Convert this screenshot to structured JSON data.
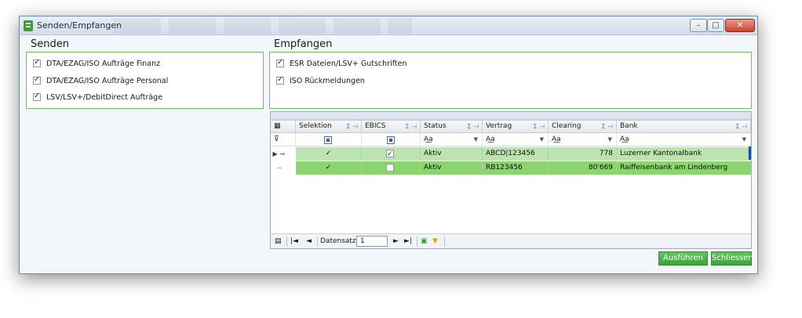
{
  "window": {
    "title": "Senden/Empfangen",
    "min_label": "–",
    "max_label": "□",
    "close_label": "✕"
  },
  "senden": {
    "label": "Senden",
    "items": [
      {
        "label": "DTA/EZAG/ISO Aufträge Finanz",
        "checked": true
      },
      {
        "label": "DTA/EZAG/ISO Aufträge Personal",
        "checked": true
      },
      {
        "label": "LSV/LSV+/DebitDirect Aufträge",
        "checked": true
      }
    ]
  },
  "empfangen": {
    "label": "Empfangen",
    "items": [
      {
        "label": "ESR Dateien/LSV+ Gutschriften",
        "checked": true
      },
      {
        "label": "ISO Rückmeldungen",
        "checked": true
      }
    ]
  },
  "grid": {
    "columns": [
      "Selektion",
      "EBICS",
      "Status",
      "Vertrag",
      "Clearing",
      "Bank"
    ],
    "filter_op": "A͟a",
    "rows": [
      {
        "selektion": "✓",
        "ebics": true,
        "status": "Aktiv",
        "vertrag": "ABCD|123456",
        "clearing": "778",
        "bank": "Luzerner Kantonalbank"
      },
      {
        "selektion": "✓",
        "ebics": false,
        "status": "Aktiv",
        "vertrag": "RB123456",
        "clearing": "80'669",
        "bank": "Raiffeisenbank am Lindenberg"
      }
    ],
    "navigator": {
      "first": "|◄",
      "prev": "◄",
      "record_label": "Datensatz",
      "record_value": "1",
      "next": "►",
      "last": "►|"
    }
  },
  "buttons": {
    "execute": "Ausführen",
    "close": "Schliessen"
  },
  "colors": {
    "accent_green": "#6cc36a",
    "row_selected": "#bde3b1",
    "row_green": "#8cd46f",
    "button_green": "#4fb34b"
  }
}
